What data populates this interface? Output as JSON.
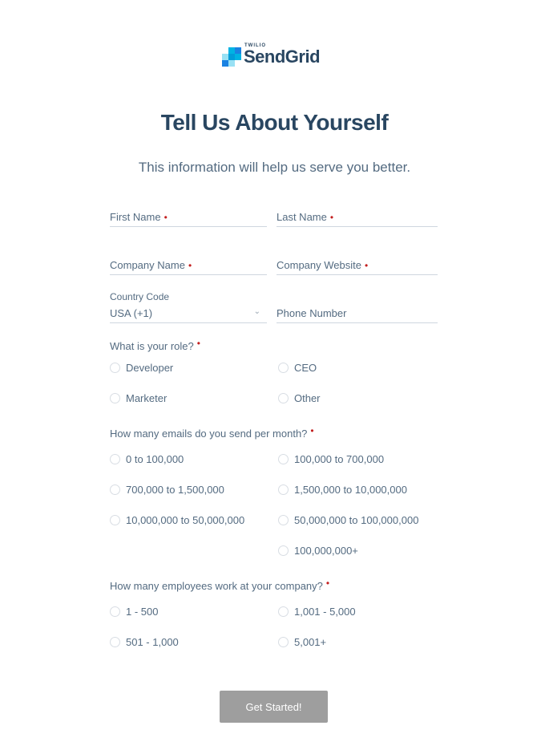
{
  "brand": {
    "parent": "TWILIO",
    "name": "SendGrid",
    "colors": {
      "dark": "#294661",
      "blue": "#1a82e2",
      "cyan": "#00b3e3",
      "light": "#99e1f4"
    }
  },
  "title": "Tell Us About Yourself",
  "subtitle": "This information will help us serve you better.",
  "fields": {
    "first_name": {
      "label": "First Name",
      "required": "•"
    },
    "last_name": {
      "label": "Last Name",
      "required": "•"
    },
    "company_name": {
      "label": "Company Name",
      "required": "•"
    },
    "company_website": {
      "label": "Company Website",
      "required": "•"
    },
    "country_code": {
      "label": "Country Code",
      "value": "USA (+1)"
    },
    "phone_number": {
      "label": "Phone Number"
    }
  },
  "role": {
    "question": "What is your role?",
    "required": "•",
    "options": [
      "Developer",
      "CEO",
      "Marketer",
      "Other"
    ]
  },
  "emails": {
    "question": "How many emails do you send per month?",
    "required": "•",
    "options": [
      "0 to 100,000",
      "100,000 to 700,000",
      "700,000 to 1,500,000",
      "1,500,000 to 10,000,000",
      "10,000,000 to 50,000,000",
      "50,000,000 to 100,000,000",
      "100,000,000+"
    ]
  },
  "employees": {
    "question": "How many employees work at your company?",
    "required": "•",
    "options": [
      "1 - 500",
      "1,001 - 5,000",
      "501 - 1,000",
      "5,001+"
    ]
  },
  "submit_label": "Get Started!"
}
